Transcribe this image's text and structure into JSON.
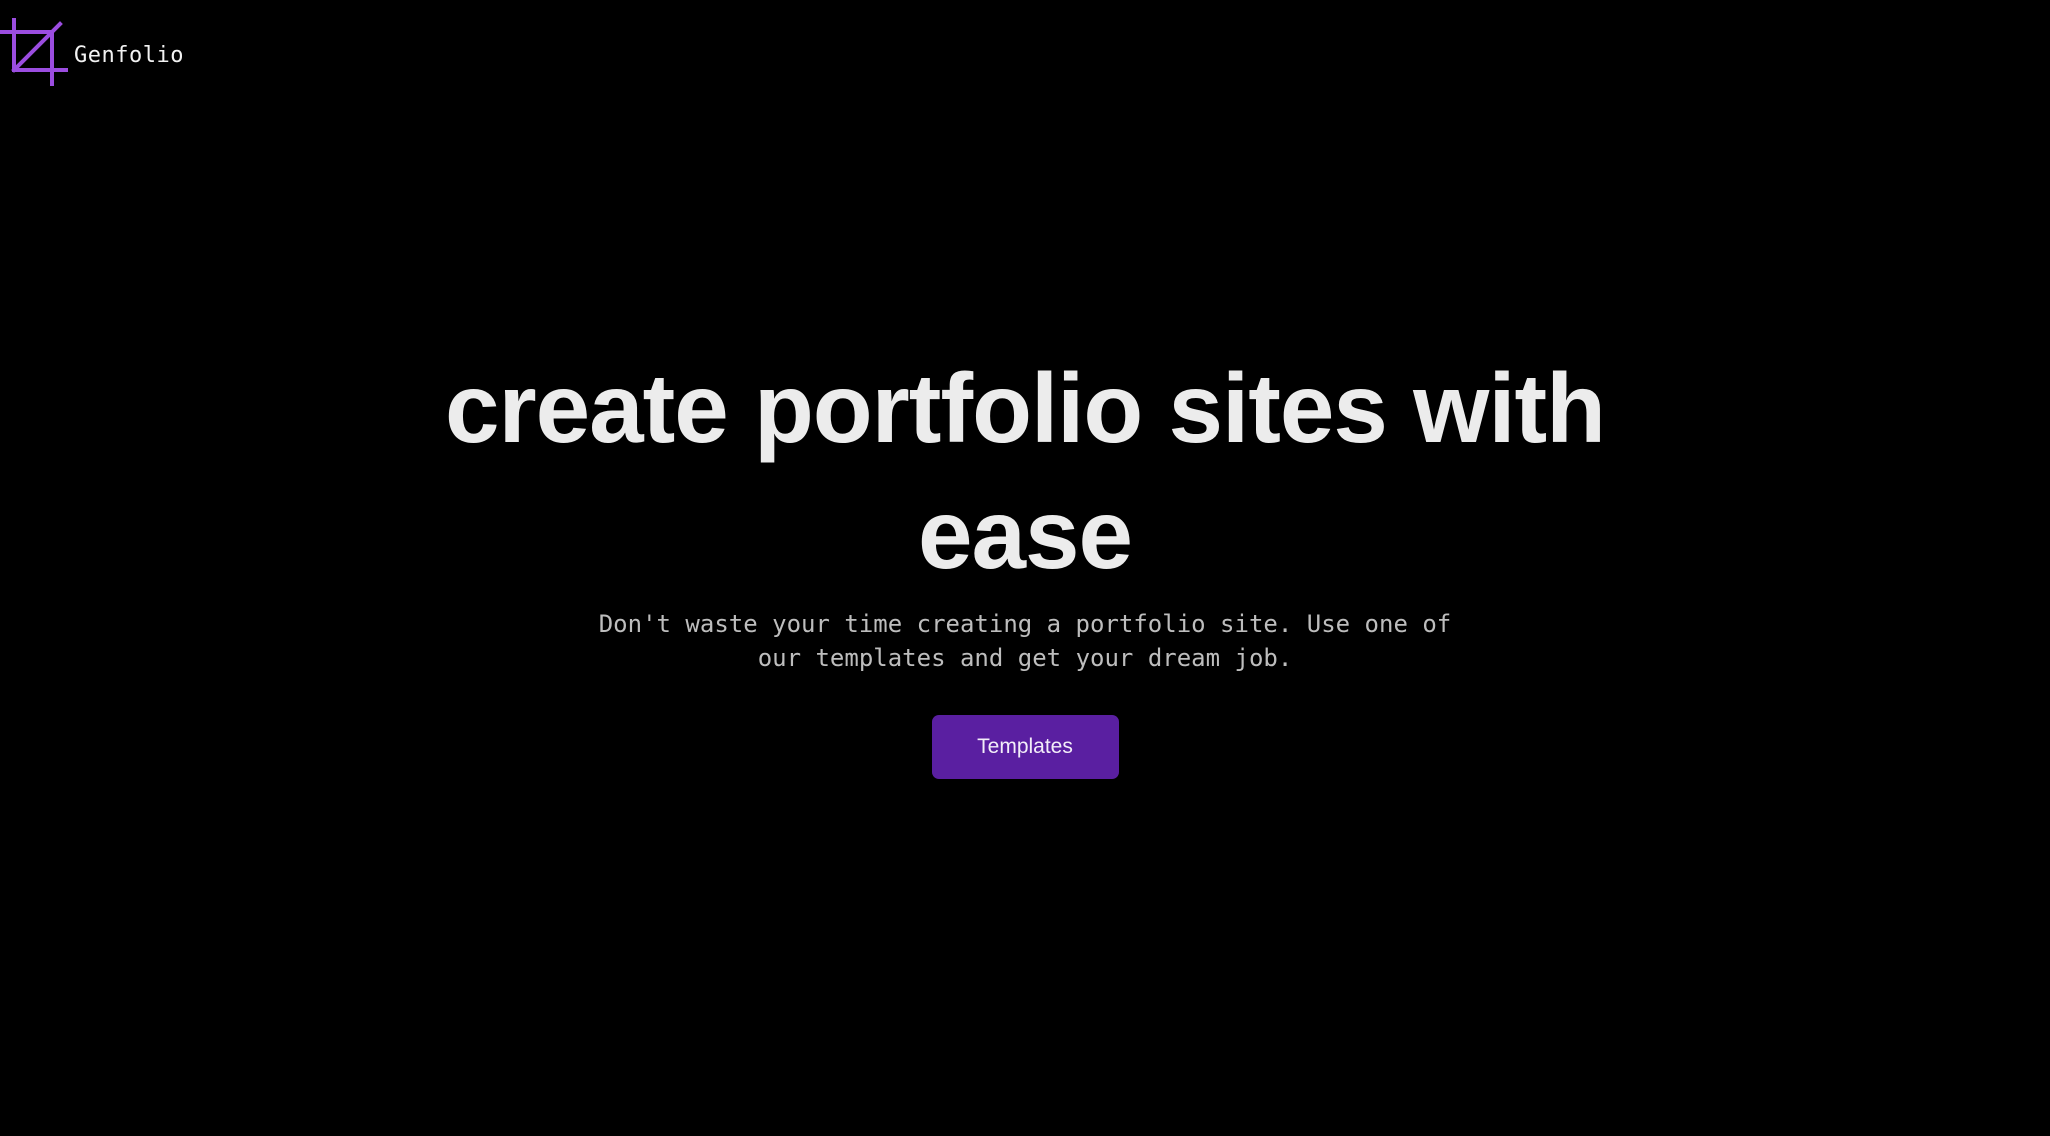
{
  "header": {
    "logo_icon": "crop-icon",
    "brand_name": "Genfolio"
  },
  "hero": {
    "headline": "create portfolio sites with ease",
    "subtitle": "Don't waste your time creating a portfolio site. Use one of our templates and get your dream job.",
    "cta_label": "Templates"
  },
  "colors": {
    "background": "#000000",
    "accent": "#5a1fa1",
    "logo": "#9b4de0",
    "headline": "#ececec",
    "subtitle": "#bdbdbd"
  }
}
